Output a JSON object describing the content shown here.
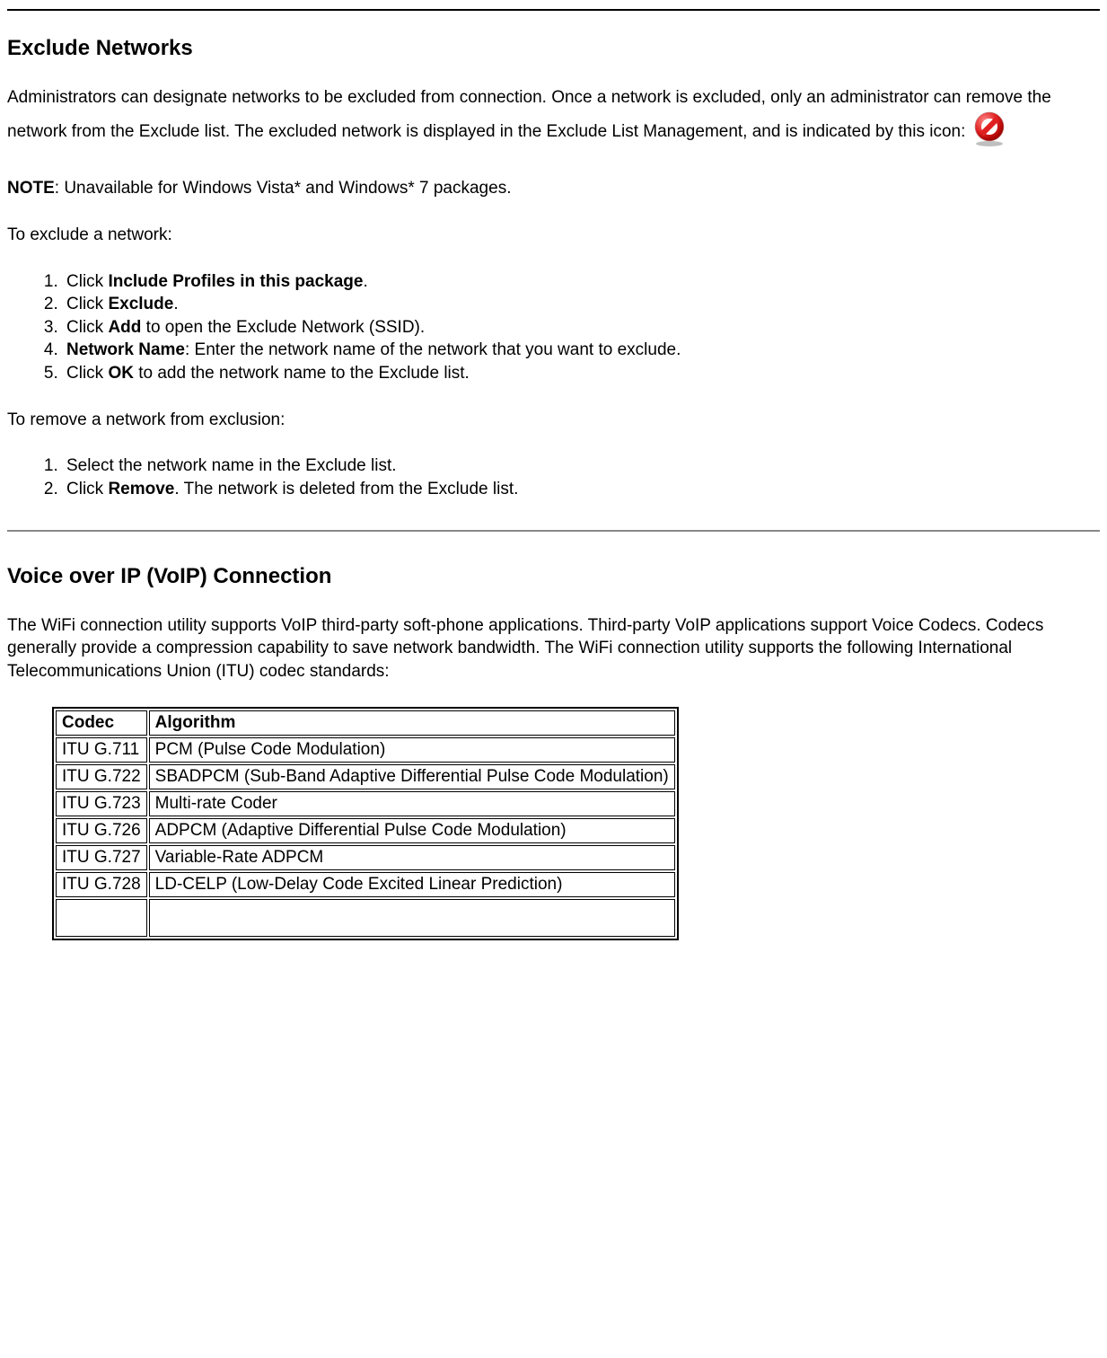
{
  "exclude": {
    "heading": "Exclude Networks",
    "intro_part1": "Administrators can designate networks to be excluded from connection. Once a network is excluded, only an administrator can remove the network from the Exclude list. The excluded network is displayed in the Exclude List Management, and is indicated by this icon:",
    "note_label": "NOTE",
    "note_text": ": Unavailable for Windows Vista* and Windows* 7 packages.",
    "to_exclude_label": "To exclude a network:",
    "steps_exclude": [
      {
        "pre": "Click ",
        "bold": "Include Profiles in this package",
        "post": "."
      },
      {
        "pre": "Click ",
        "bold": "Exclude",
        "post": "."
      },
      {
        "pre": "Click ",
        "bold": "Add",
        "post": " to open the Exclude Network (SSID)."
      },
      {
        "pre": "",
        "bold": "Network Name",
        "post": ": Enter the network name of the network that you want to exclude."
      },
      {
        "pre": "Click ",
        "bold": "OK",
        "post": " to add the network name to the Exclude list."
      }
    ],
    "to_remove_label": "To remove a network from exclusion:",
    "steps_remove": [
      {
        "pre": "Select the network name in the Exclude list.",
        "bold": "",
        "post": ""
      },
      {
        "pre": "Click ",
        "bold": "Remove",
        "post": ". The network is deleted from the Exclude list."
      }
    ]
  },
  "voip": {
    "heading": "Voice over IP (VoIP) Connection",
    "intro": "The WiFi connection utility supports VoIP third-party soft-phone applications. Third-party VoIP applications support Voice Codecs. Codecs generally provide a compression capability to save network bandwidth. The WiFi connection utility supports the following International Telecommunications Union (ITU) codec standards:",
    "table": {
      "headers": [
        "Codec",
        "Algorithm"
      ],
      "rows": [
        [
          "ITU G.711",
          "PCM (Pulse Code Modulation)"
        ],
        [
          "ITU G.722",
          "SBADPCM (Sub-Band Adaptive Differential Pulse Code Modulation)"
        ],
        [
          "ITU G.723",
          "Multi-rate Coder"
        ],
        [
          "ITU G.726",
          "ADPCM (Adaptive Differential Pulse Code Modulation)"
        ],
        [
          "ITU G.727",
          "Variable-Rate ADPCM"
        ],
        [
          "ITU G.728",
          "LD-CELP (Low-Delay Code Excited Linear Prediction)"
        ]
      ]
    }
  }
}
